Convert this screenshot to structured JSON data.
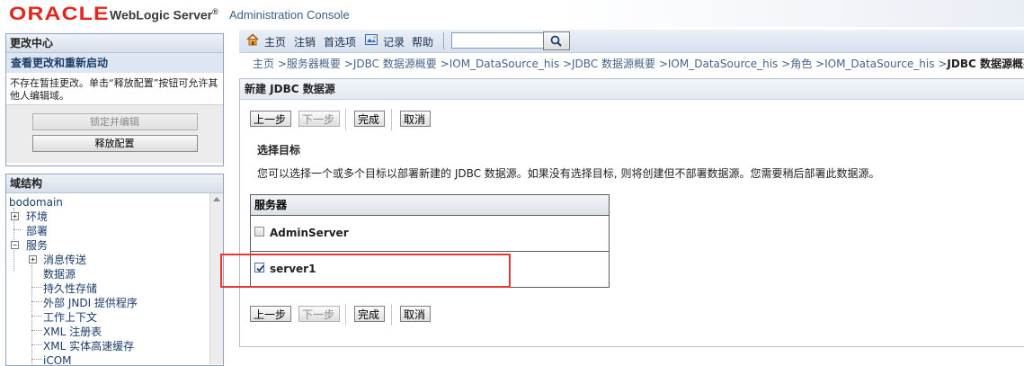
{
  "header": {
    "oracle": "ORACLE",
    "product": "WebLogic Server",
    "registered": "®",
    "console": "Administration Console"
  },
  "change_center": {
    "title": "更改中心",
    "link": "查看更改和重新启动",
    "message": "不存在暂挂更改。单击“释放配置”按钮可允许其他人编辑域。",
    "lock_button": "锁定并编辑",
    "release_button": "释放配置"
  },
  "domain_structure": {
    "title": "域结构",
    "root": "bodomain",
    "items": [
      {
        "label": "环境",
        "toggle": "+"
      },
      {
        "label": "部署"
      },
      {
        "label": "服务",
        "toggle": "−"
      },
      {
        "label": "消息传送",
        "toggle": "+"
      },
      {
        "label": "数据源"
      },
      {
        "label": "持久性存储"
      },
      {
        "label": "外部 JNDI 提供程序"
      },
      {
        "label": "工作上下文"
      },
      {
        "label": "XML 注册表"
      },
      {
        "label": "XML 实体高速缓存"
      },
      {
        "label": "jCOM"
      }
    ]
  },
  "navbar": {
    "home": "主页",
    "logout": "注销",
    "preferences": "首选项",
    "record": "记录",
    "help": "帮助",
    "search_value": ""
  },
  "breadcrumb": {
    "items": [
      "主页",
      "服务器概要",
      "JDBC 数据源概要",
      "IOM_DataSource_his",
      "JDBC 数据源概要",
      "IOM_DataSource_his",
      "角色",
      "IOM_DataSource_his"
    ],
    "current": "JDBC 数据源概要"
  },
  "content": {
    "title": "新建 JDBC 数据源",
    "buttons": {
      "back": "上一步",
      "next": "下一步",
      "finish": "完成",
      "cancel": "取消"
    },
    "section_title": "选择目标",
    "description": "您可以选择一个或多个目标以部署新建的 JDBC 数据源。如果没有选择目标, 则将创建但不部署数据源。您需要稍后部署此数据源。",
    "servers_header": "服务器",
    "servers": [
      {
        "name": "AdminServer",
        "checked": false
      },
      {
        "name": "server1",
        "checked": true
      }
    ]
  },
  "colors": {
    "oracle_red": "#e3251c",
    "highlight_red": "#e53935",
    "link_blue": "#45658c"
  }
}
